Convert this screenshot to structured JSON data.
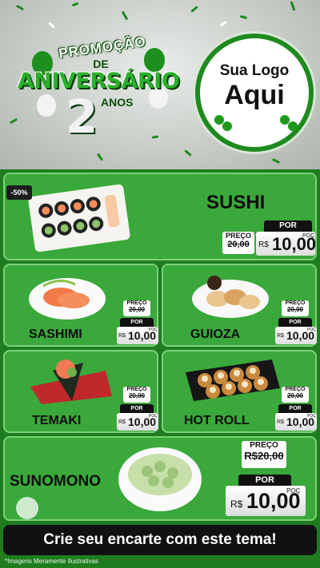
{
  "promo": {
    "line1": "PROMOÇÃO",
    "line2": "DE",
    "line3": "ANIVERSÁRIO",
    "number": "2",
    "unit": "ANOS"
  },
  "logo": {
    "line1": "Sua Logo",
    "line2": "Aqui"
  },
  "products": [
    {
      "name": "SUSHI",
      "discount": "-50%",
      "price_label": "PREÇO",
      "old_price": "20,00",
      "por_label": "POR",
      "currency": "R$",
      "new_price": "10,00",
      "unit": "POÇ"
    },
    {
      "name": "SASHIMI",
      "price_label": "PREÇO",
      "old_price": "20,00",
      "por_label": "POR",
      "currency": "R$",
      "new_price": "10,00",
      "unit": "POÇ"
    },
    {
      "name": "GUIOZA",
      "price_label": "PREÇO",
      "old_price": "20,00",
      "por_label": "POR",
      "currency": "R$",
      "new_price": "10,00",
      "unit": "POÇ"
    },
    {
      "name": "TEMAKI",
      "price_label": "PREÇO",
      "old_price": "20,00",
      "por_label": "POR",
      "currency": "R$",
      "new_price": "10,00",
      "unit": "POÇ"
    },
    {
      "name": "HOT ROLL",
      "price_label": "PREÇO",
      "old_price": "20,00",
      "por_label": "POR",
      "currency": "R$",
      "new_price": "10,00",
      "unit": "POÇ"
    },
    {
      "name": "SUNOMONO",
      "price_label": "PREÇO",
      "old_price": "R$20,00",
      "por_label": "POR",
      "currency": "R$",
      "new_price": "10,00",
      "unit": "POÇ"
    }
  ],
  "cta": "Crie seu encarte com este tema!",
  "disclaimer": "*Imagens Meramente Ilustrativas",
  "colors": {
    "brand_green": "#1f7d1f",
    "panel_green": "#3aa83a",
    "dark": "#111111"
  }
}
